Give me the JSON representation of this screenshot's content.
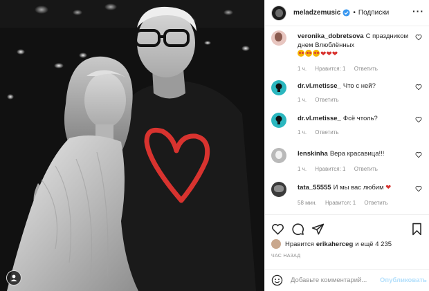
{
  "post": {
    "username": "meladzemusic",
    "separator": "•",
    "follow_label": "Подписки",
    "more_icon": "ellipsis-icon",
    "verified_icon": "verified-badge-icon"
  },
  "comments": [
    {
      "user": "veronika_dobretsova",
      "text": "С праздником днем Влюблённых",
      "emoji_line": "🤩🤩🤩❤❤❤",
      "time": "1 ч.",
      "likes": "Нравится: 1",
      "reply": "Ответить"
    },
    {
      "user": "dr.vl.metisse_",
      "text": "Что с ней?",
      "time": "1 ч.",
      "reply": "Ответить"
    },
    {
      "user": "dr.vl.metisse_",
      "text": "Фсё чтоль?",
      "time": "1 ч.",
      "reply": "Ответить"
    },
    {
      "user": "lenskinha",
      "text": "Вера красавица!!!",
      "time": "1 ч.",
      "likes": "Нравится: 1",
      "reply": "Ответить"
    },
    {
      "user": "tata_55555",
      "text": "И мы вас любим",
      "heart": "❤",
      "time": "58 мин.",
      "likes": "Нравится: 1",
      "reply": "Ответить"
    }
  ],
  "actions": {
    "like_icon": "heart-outline-icon",
    "comment_icon": "comment-bubble-icon",
    "share_icon": "paper-plane-icon",
    "save_icon": "bookmark-icon"
  },
  "likes_line": {
    "prefix": "Нравится",
    "user": "erikaherceg",
    "suffix": "и ещё 4 235"
  },
  "timestamp": "ЧАС НАЗАД",
  "composer": {
    "placeholder": "Добавьте комментарий...",
    "publish_label": "Опубликовать",
    "emoji_icon": "smiley-icon"
  },
  "colors": {
    "heart_red": "#d8332f",
    "verified_blue": "#3897f0",
    "publish_disabled": "#b2dffc",
    "meta_gray": "#8e8e8e"
  }
}
